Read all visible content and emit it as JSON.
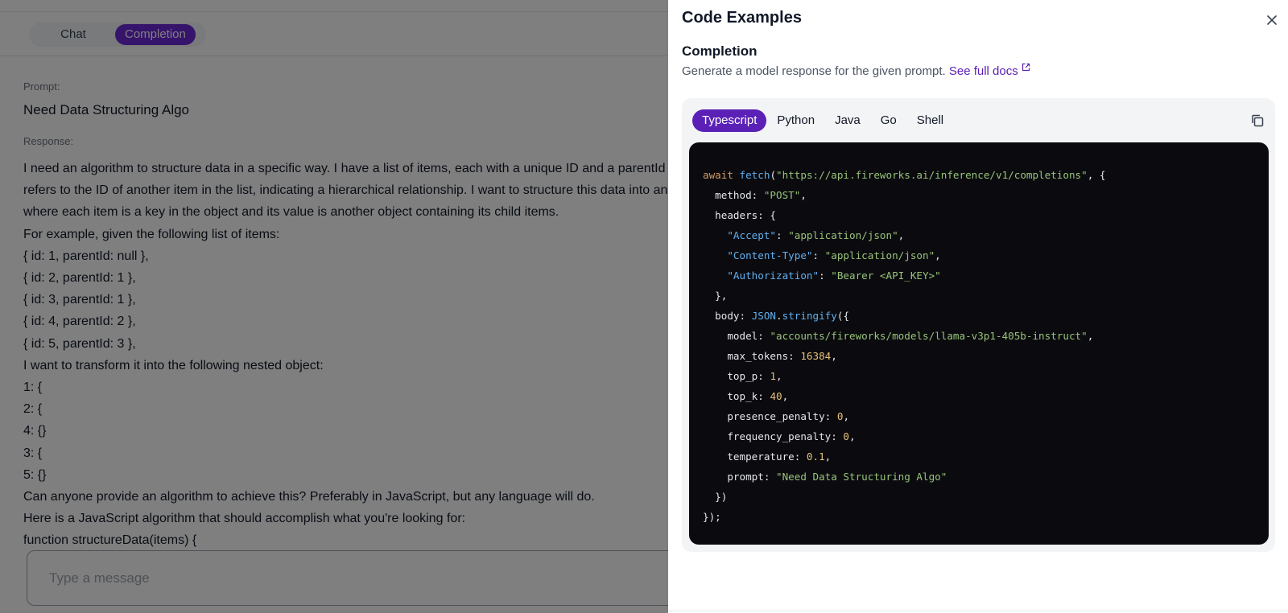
{
  "app": {
    "modes": [
      {
        "label": "Chat",
        "active": false
      },
      {
        "label": "Completion",
        "active": true
      }
    ],
    "prompt_label": "Prompt:",
    "prompt_value": "Need Data Structuring Algo",
    "response_label": "Response:",
    "response_lines": [
      "I need an algorithm to structure data in a specific way. I have a list of items, each with a unique ID and a parentId that",
      "refers to the ID of another item in the list, indicating a hierarchical relationship. I want to structure this data into an object",
      "where each item is a key in the object and its value is another object containing its child items.",
      "For example, given the following list of items:",
      "{ id: 1, parentId: null },",
      "{ id: 2, parentId: 1 },",
      "{ id: 3, parentId: 1 },",
      "{ id: 4, parentId: 2 },",
      "{ id: 5, parentId: 3 },",
      "I want to transform it into the following nested object:",
      "1: {",
      "2: {",
      "4: {}",
      "3: {",
      "5: {}",
      "Can anyone provide an algorithm to achieve this? Preferably in JavaScript, but any language will do.",
      "Here is a JavaScript algorithm that should accomplish what you're looking for:",
      "function structureData(items) {"
    ],
    "message_placeholder": "Type a message"
  },
  "drawer": {
    "title": "Code Examples",
    "section_title": "Completion",
    "description": "Generate a model response for the given prompt.",
    "docs_link": "See full docs",
    "languages": [
      {
        "label": "Typescript",
        "active": true
      },
      {
        "label": "Python",
        "active": false
      },
      {
        "label": "Java",
        "active": false
      },
      {
        "label": "Go",
        "active": false
      },
      {
        "label": "Shell",
        "active": false
      }
    ],
    "code": {
      "await": "await",
      "fetch": "fetch",
      "url": "\"https://api.fireworks.ai/inference/v1/completions\"",
      "method_key": "method",
      "method_val": "\"POST\"",
      "headers_key": "headers",
      "accept_key": "\"Accept\"",
      "accept_val": "\"application/json\"",
      "ctype_key": "\"Content-Type\"",
      "ctype_val": "\"application/json\"",
      "auth_key": "\"Authorization\"",
      "auth_val": "\"Bearer <API_KEY>\"",
      "body_key": "body",
      "json_obj": "JSON",
      "stringify": "stringify",
      "model_key": "model",
      "model_val": "\"accounts/fireworks/models/llama-v3p1-405b-instruct\"",
      "max_tokens_key": "max_tokens",
      "max_tokens_val": "16384",
      "top_p_key": "top_p",
      "top_p_val": "1",
      "top_k_key": "top_k",
      "top_k_val": "40",
      "presence_key": "presence_penalty",
      "presence_val": "0",
      "frequency_key": "frequency_penalty",
      "frequency_val": "0",
      "temperature_key": "temperature",
      "temperature_val": "0.1",
      "prompt_key": "prompt",
      "prompt_val": "\"Need Data Structuring Algo\""
    }
  },
  "colors": {
    "accent": "#5b21b6",
    "code_bg": "#0b0b0f",
    "overlay": "rgba(0,0,0,0.5)"
  },
  "icons": [
    "close-icon",
    "external-link-icon",
    "copy-icon"
  ]
}
